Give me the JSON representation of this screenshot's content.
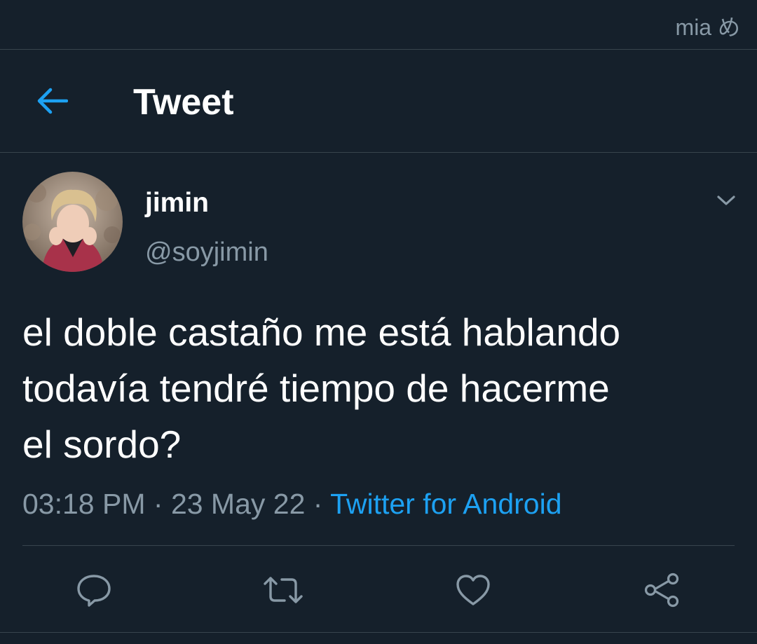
{
  "status_bar": {
    "watermark": "mia め"
  },
  "header": {
    "title": "Tweet",
    "back_icon": "arrow-left-icon"
  },
  "tweet": {
    "author": {
      "name": "jimin",
      "handle": "@soyjimin",
      "avatar": "profile-photo"
    },
    "menu_icon": "chevron-down-icon",
    "text": "el doble castaño me está hablando\ntodavía tendré tiempo de hacerme\nel sordo?",
    "meta": {
      "time": "03:18 PM",
      "separator": " · ",
      "date": "23 May 22",
      "source": "Twitter for Android"
    },
    "actions": [
      {
        "icon": "reply-icon"
      },
      {
        "icon": "retweet-icon"
      },
      {
        "icon": "like-icon"
      },
      {
        "icon": "share-icon"
      }
    ]
  },
  "colors": {
    "background": "#15202b",
    "text": "#ffffff",
    "secondary_text": "#8899a6",
    "accent": "#1da1f2",
    "border": "#38444d"
  }
}
